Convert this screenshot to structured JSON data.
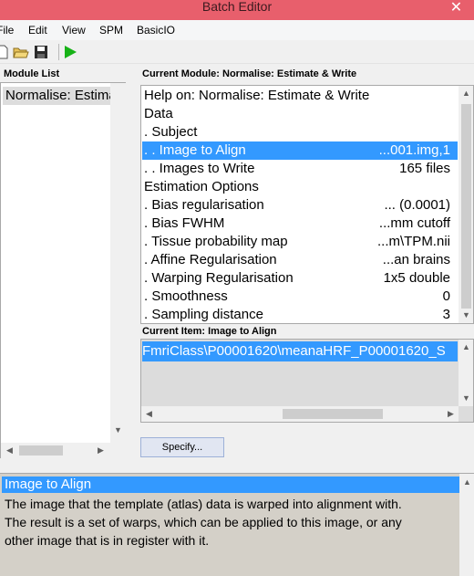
{
  "window": {
    "title": "Batch Editor",
    "close_glyph": "✕"
  },
  "menu": [
    "File",
    "Edit",
    "View",
    "SPM",
    "BasicIO"
  ],
  "toolbar": {
    "icons": [
      "new-file-icon",
      "open-folder-icon",
      "save-icon",
      "run-icon"
    ]
  },
  "module_list": {
    "label": "Module List",
    "items": [
      "Normalise: Estimate & Write"
    ]
  },
  "current_module": {
    "label": "Current Module: Normalise: Estimate & Write",
    "rows": [
      {
        "label": "Help on: Normalise: Estimate & Write",
        "value": ""
      },
      {
        "label": "Data",
        "value": ""
      },
      {
        "label": ". Subject",
        "value": ""
      },
      {
        "label": ". . Image to Align",
        "value": "...001.img,1"
      },
      {
        "label": ". . Images to Write",
        "value": "165 files"
      },
      {
        "label": "Estimation Options",
        "value": ""
      },
      {
        "label": ". Bias regularisation",
        "value": "... (0.0001)"
      },
      {
        "label": ". Bias FWHM",
        "value": "...mm cutoff"
      },
      {
        "label": ". Tissue probability map",
        "value": "...m\\TPM.nii"
      },
      {
        "label": ". Affine Regularisation",
        "value": "...an brains"
      },
      {
        "label": ". Warping Regularisation",
        "value": "1x5 double"
      },
      {
        "label": ". Smoothness",
        "value": "0"
      },
      {
        "label": ". Sampling distance",
        "value": "3"
      }
    ],
    "selected_index": 3
  },
  "current_item": {
    "label": "Current Item: Image to Align",
    "value": "FmriClass\\P00001620\\meanaHRF_P00001620_S"
  },
  "specify_button": "Specify...",
  "help": {
    "title": "Image to Align",
    "lines": [
      "The  image that the template (atlas) data is warped into alignment with.",
      "The  result  is a set of warps, which can be applied to this image, or any",
      "other image that is in register with it."
    ]
  },
  "colors": {
    "titlebar": "#e85f6c",
    "selection": "#3399ff",
    "help_bg": "#d4d0c8"
  }
}
